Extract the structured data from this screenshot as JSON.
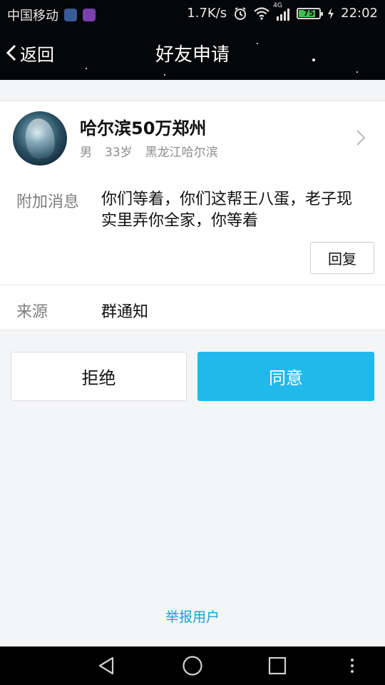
{
  "status_bar": {
    "carrier": "中国移动",
    "speed": "1.7K/s",
    "network": "4G",
    "battery": "75",
    "battery_level_percent": 75,
    "time": "22:02",
    "colors": {
      "battery_green": "#43c14b"
    },
    "icons": [
      "weather-app-icon",
      "gallery-app-icon",
      "alarm-icon",
      "wifi-icon",
      "signal-icon",
      "battery-icon",
      "charging-icon"
    ]
  },
  "header": {
    "back_label": "返回",
    "title": "好友申请"
  },
  "profile": {
    "name": "哈尔滨50万郑州",
    "gender": "男",
    "age": "33岁",
    "location": "黑龙江哈尔滨"
  },
  "message": {
    "label": "附加消息",
    "text": "你们等着，你们这帮王八蛋，老子现实里弄你全家，你等着",
    "reply_label": "回复"
  },
  "source": {
    "label": "来源",
    "value": "群通知"
  },
  "actions": {
    "reject_label": "拒绝",
    "agree_label": "同意",
    "agree_color": "#21b8ec"
  },
  "report_label": "举报用户",
  "nav_icons": [
    "back-triangle-icon",
    "home-circle-icon",
    "recents-square-icon",
    "more-dots-icon"
  ]
}
